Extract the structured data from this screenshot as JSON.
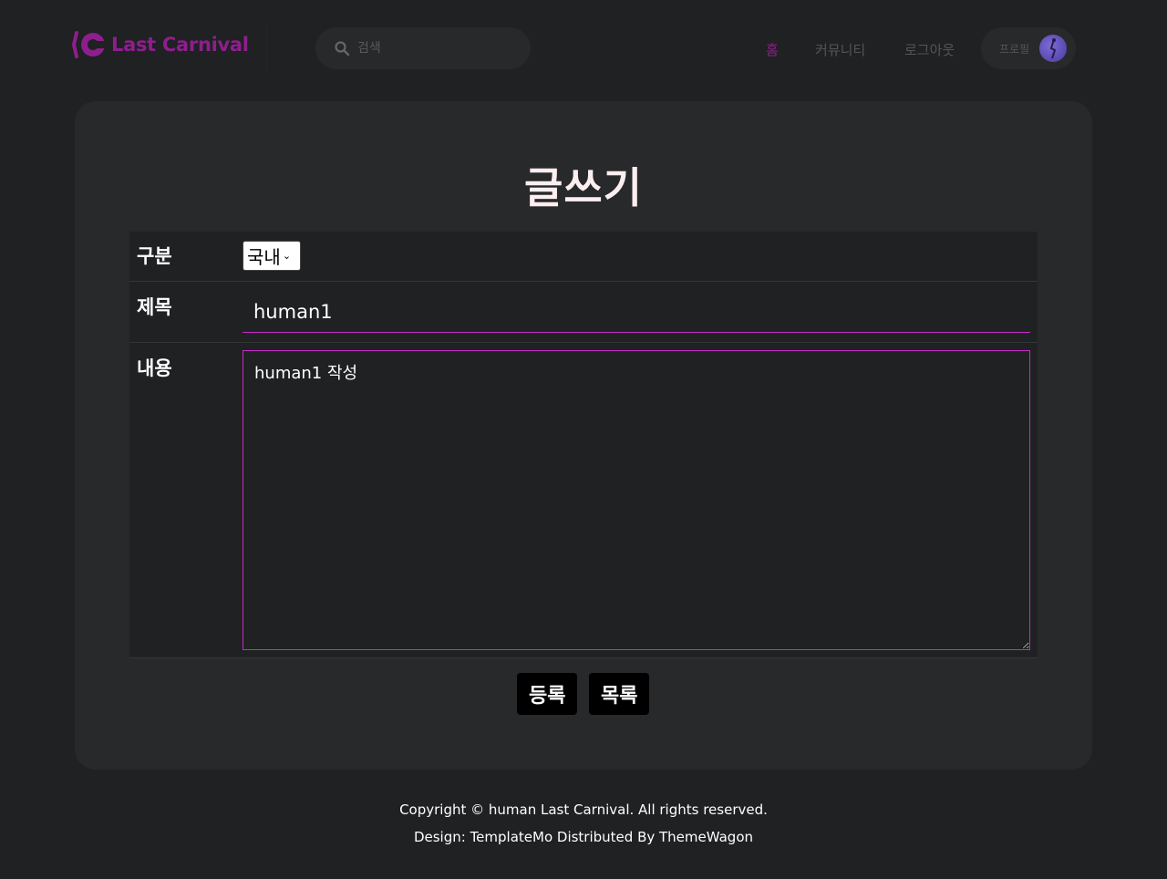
{
  "header": {
    "logo_text": "Last Carnival",
    "search_placeholder": "검색",
    "nav": [
      {
        "label": "홈",
        "active": true
      },
      {
        "label": "커뮤니티",
        "active": false
      },
      {
        "label": "로그아웃",
        "active": false
      }
    ],
    "profile_label": "프로필"
  },
  "page": {
    "title": "글쓰기"
  },
  "form": {
    "category_label": "구분",
    "category_value": "국내",
    "subject_label": "제목",
    "subject_value": "human1",
    "content_label": "내용",
    "content_value": "human1 작성"
  },
  "buttons": {
    "submit": "등록",
    "list": "목록"
  },
  "footer": {
    "copyright": "Copyright © human Last Carnival. All rights reserved.",
    "credit": "Design: TemplateMo Distributed By ThemeWagon"
  },
  "colors": {
    "accent": "#8e1e8e",
    "field_border": "#c829c8",
    "background": "#1f2122",
    "card": "#27292a"
  }
}
